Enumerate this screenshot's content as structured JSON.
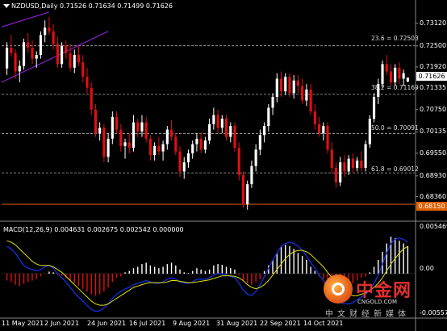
{
  "header": {
    "symbol": "NZDUSD,Daily",
    "ohlc": "0.71526 0.71634 0.71499 0.71626",
    "menu_icon": "triangle-down-icon"
  },
  "macd_header": "MACD(12,26,9) 0.004631 0.002675 0.002542 0.000000",
  "price_axis": {
    "ticks": [
      "0.73120",
      "0.72500",
      "0.71920",
      "0.71335",
      "0.70750",
      "0.70135",
      "0.69550",
      "0.68930",
      "0.68360"
    ],
    "current_price": "0.71626",
    "hline_price": "0.68150"
  },
  "macd_axis": {
    "ticks": [
      "0.005469",
      "0.00",
      "-0.005573"
    ]
  },
  "fib_levels": [
    {
      "label": "23.6 = 0.72503",
      "price": 0.72503
    },
    {
      "label": "38.2 = 0.71169",
      "price": 0.71169
    },
    {
      "label": "50.0 = 0.70091",
      "price": 0.70091
    },
    {
      "label": "61.8 = 0.69012",
      "price": 0.69012
    }
  ],
  "date_labels": [
    "11 May 2021",
    "2 Jun 2021",
    "24 Jun 2021",
    "16 Jul 2021",
    "9 Aug 2021",
    "31 Aug 2021",
    "22 Sep 2021",
    "14 Oct 2021"
  ],
  "watermark": {
    "brand": "中金网",
    "url": "CNGOLD.COM",
    "subtitle": "中文财经新媒体"
  },
  "colors": {
    "background": "#000000",
    "bull": "#ffffff",
    "bear": "#e01010",
    "macd_line": "#1030e0",
    "signal_line": "#e0e000",
    "channel": "#a020f0",
    "hline": "#e06000"
  },
  "chart_data": {
    "type": "candlestick",
    "ylim": [
      0.6795,
      0.7345
    ],
    "candles": [
      [
        0.7188,
        0.726,
        0.717,
        0.7245
      ],
      [
        0.7245,
        0.728,
        0.722,
        0.723
      ],
      [
        0.723,
        0.724,
        0.716,
        0.718
      ],
      [
        0.718,
        0.721,
        0.715,
        0.7195
      ],
      [
        0.7195,
        0.727,
        0.7185,
        0.726
      ],
      [
        0.726,
        0.7285,
        0.723,
        0.7245
      ],
      [
        0.7245,
        0.7265,
        0.72,
        0.7215
      ],
      [
        0.7215,
        0.7235,
        0.719,
        0.7225
      ],
      [
        0.7225,
        0.729,
        0.7215,
        0.728
      ],
      [
        0.728,
        0.732,
        0.726,
        0.73
      ],
      [
        0.73,
        0.733,
        0.728,
        0.729
      ],
      [
        0.729,
        0.731,
        0.724,
        0.7255
      ],
      [
        0.7255,
        0.7275,
        0.719,
        0.72
      ],
      [
        0.72,
        0.726,
        0.719,
        0.725
      ],
      [
        0.725,
        0.7265,
        0.7215,
        0.723
      ],
      [
        0.723,
        0.7255,
        0.718,
        0.719
      ],
      [
        0.719,
        0.724,
        0.7175,
        0.7225
      ],
      [
        0.7225,
        0.725,
        0.7195,
        0.7205
      ],
      [
        0.7205,
        0.7225,
        0.715,
        0.7165
      ],
      [
        0.7165,
        0.719,
        0.712,
        0.7135
      ],
      [
        0.7135,
        0.715,
        0.706,
        0.7075
      ],
      [
        0.7075,
        0.709,
        0.7,
        0.701
      ],
      [
        0.701,
        0.704,
        0.699,
        0.7025
      ],
      [
        0.7025,
        0.7035,
        0.693,
        0.6945
      ],
      [
        0.6945,
        0.701,
        0.693,
        0.6995
      ],
      [
        0.6995,
        0.707,
        0.698,
        0.7055
      ],
      [
        0.7055,
        0.707,
        0.701,
        0.702
      ],
      [
        0.702,
        0.7035,
        0.696,
        0.6975
      ],
      [
        0.6975,
        0.6995,
        0.694,
        0.6985
      ],
      [
        0.6985,
        0.701,
        0.6955,
        0.697
      ],
      [
        0.697,
        0.706,
        0.696,
        0.704
      ],
      [
        0.704,
        0.705,
        0.7,
        0.7015
      ],
      [
        0.7015,
        0.706,
        0.7,
        0.704
      ],
      [
        0.704,
        0.7055,
        0.6985,
        0.6995
      ],
      [
        0.6995,
        0.7005,
        0.6935,
        0.695
      ],
      [
        0.695,
        0.6985,
        0.6935,
        0.6975
      ],
      [
        0.6975,
        0.7,
        0.695,
        0.696
      ],
      [
        0.696,
        0.699,
        0.6935,
        0.698
      ],
      [
        0.698,
        0.703,
        0.6965,
        0.702
      ],
      [
        0.702,
        0.7045,
        0.699,
        0.7
      ],
      [
        0.7,
        0.701,
        0.695,
        0.696
      ],
      [
        0.696,
        0.6975,
        0.689,
        0.6905
      ],
      [
        0.6905,
        0.6945,
        0.6885,
        0.693
      ],
      [
        0.693,
        0.6965,
        0.6915,
        0.6955
      ],
      [
        0.6955,
        0.699,
        0.694,
        0.698
      ],
      [
        0.698,
        0.701,
        0.696,
        0.6995
      ],
      [
        0.6995,
        0.701,
        0.6955,
        0.6965
      ],
      [
        0.6965,
        0.7,
        0.6955,
        0.699
      ],
      [
        0.699,
        0.705,
        0.698,
        0.7035
      ],
      [
        0.7035,
        0.708,
        0.702,
        0.706
      ],
      [
        0.706,
        0.7075,
        0.701,
        0.7025
      ],
      [
        0.7025,
        0.706,
        0.701,
        0.705
      ],
      [
        0.705,
        0.706,
        0.699,
        0.7
      ],
      [
        0.7,
        0.704,
        0.6985,
        0.703
      ],
      [
        0.703,
        0.704,
        0.696,
        0.697
      ],
      [
        0.697,
        0.6985,
        0.688,
        0.6895
      ],
      [
        0.6895,
        0.6905,
        0.6805,
        0.6815
      ],
      [
        0.6815,
        0.688,
        0.68,
        0.687
      ],
      [
        0.687,
        0.6935,
        0.686,
        0.692
      ],
      [
        0.692,
        0.698,
        0.6905,
        0.6965
      ],
      [
        0.6965,
        0.702,
        0.695,
        0.7005
      ],
      [
        0.7005,
        0.704,
        0.6985,
        0.703
      ],
      [
        0.703,
        0.709,
        0.7015,
        0.708
      ],
      [
        0.708,
        0.712,
        0.706,
        0.711
      ],
      [
        0.711,
        0.7175,
        0.7095,
        0.716
      ],
      [
        0.716,
        0.718,
        0.711,
        0.7125
      ],
      [
        0.7125,
        0.7175,
        0.7115,
        0.7165
      ],
      [
        0.7165,
        0.7175,
        0.711,
        0.712
      ],
      [
        0.712,
        0.717,
        0.7105,
        0.7155
      ],
      [
        0.7155,
        0.717,
        0.712,
        0.714
      ],
      [
        0.714,
        0.716,
        0.709,
        0.71
      ],
      [
        0.71,
        0.7145,
        0.7085,
        0.713
      ],
      [
        0.713,
        0.7145,
        0.706,
        0.707
      ],
      [
        0.707,
        0.709,
        0.702,
        0.7035
      ],
      [
        0.7035,
        0.7055,
        0.7,
        0.701
      ],
      [
        0.701,
        0.704,
        0.699,
        0.703
      ],
      [
        0.703,
        0.704,
        0.6955,
        0.6965
      ],
      [
        0.6965,
        0.6985,
        0.69,
        0.6915
      ],
      [
        0.6915,
        0.693,
        0.686,
        0.6875
      ],
      [
        0.6875,
        0.6945,
        0.6865,
        0.693
      ],
      [
        0.693,
        0.695,
        0.689,
        0.6905
      ],
      [
        0.6905,
        0.695,
        0.6895,
        0.694
      ],
      [
        0.694,
        0.6955,
        0.69,
        0.6915
      ],
      [
        0.6915,
        0.6945,
        0.6905,
        0.6935
      ],
      [
        0.6935,
        0.696,
        0.6905,
        0.6915
      ],
      [
        0.6915,
        0.699,
        0.6905,
        0.698
      ],
      [
        0.698,
        0.706,
        0.697,
        0.705
      ],
      [
        0.705,
        0.712,
        0.704,
        0.711
      ],
      [
        0.711,
        0.716,
        0.709,
        0.7145
      ],
      [
        0.7145,
        0.721,
        0.7135,
        0.72
      ],
      [
        0.72,
        0.7225,
        0.717,
        0.718
      ],
      [
        0.718,
        0.72,
        0.714,
        0.715
      ],
      [
        0.715,
        0.72,
        0.714,
        0.719
      ],
      [
        0.719,
        0.7205,
        0.7145,
        0.716
      ],
      [
        0.716,
        0.7185,
        0.714,
        0.7175
      ],
      [
        0.7152,
        0.7163,
        0.715,
        0.7163
      ]
    ],
    "macd_histogram": [
      -0.001,
      -0.0012,
      -0.0016,
      -0.0018,
      -0.0015,
      -0.0012,
      -0.001,
      -0.0008,
      -0.0004,
      0.0,
      0.0003,
      0.0002,
      -0.0002,
      -0.0003,
      -0.0006,
      -0.001,
      -0.0014,
      -0.0018,
      -0.0022,
      -0.0026,
      -0.003,
      -0.0032,
      -0.003,
      -0.0026,
      -0.002,
      -0.0012,
      -0.0006,
      -0.0004,
      0.0002,
      0.0004,
      0.0008,
      0.001,
      0.0014,
      0.0016,
      0.0012,
      0.001,
      0.0008,
      0.001,
      0.0014,
      0.0016,
      0.0012,
      0.0006,
      0.0002,
      0.0001,
      0.0004,
      0.0008,
      0.0006,
      0.0004,
      0.0006,
      0.0012,
      0.0014,
      0.0013,
      0.001,
      0.0008,
      0.0006,
      -0.0002,
      -0.001,
      -0.0014,
      -0.0016,
      -0.0012,
      -0.0008,
      0.0004,
      0.0012,
      0.002,
      0.003,
      0.004,
      0.0042,
      0.004,
      0.0036,
      0.003,
      0.0026,
      0.002,
      0.001,
      0.0004,
      -0.0004,
      -0.0008,
      -0.0014,
      -0.002,
      -0.0024,
      -0.0022,
      -0.002,
      -0.0016,
      -0.0014,
      -0.001,
      -0.0006,
      -0.0004,
      0.0002,
      0.001,
      0.002,
      0.0032,
      0.0044,
      0.0054,
      0.0052,
      0.0048,
      0.0044,
      0.004
    ],
    "macd_line": [
      0.004,
      0.0036,
      0.003,
      0.002,
      0.0012,
      0.0008,
      0.0006,
      0.0004,
      0.0006,
      0.001,
      0.0012,
      0.0008,
      0.0,
      -0.0006,
      -0.0012,
      -0.002,
      -0.0028,
      -0.0034,
      -0.004,
      -0.0046,
      -0.0052,
      -0.0055,
      -0.0054,
      -0.005,
      -0.0044,
      -0.0036,
      -0.003,
      -0.0026,
      -0.0022,
      -0.002,
      -0.0016,
      -0.0014,
      -0.0012,
      -0.001,
      -0.0012,
      -0.0014,
      -0.0014,
      -0.0012,
      -0.0008,
      -0.0006,
      -0.0008,
      -0.0012,
      -0.0014,
      -0.0014,
      -0.0012,
      -0.0008,
      -0.0008,
      -0.0008,
      -0.0006,
      -0.0002,
      0.0,
      0.0,
      -0.0002,
      -0.0004,
      -0.0006,
      -0.0014,
      -0.0024,
      -0.003,
      -0.0032,
      -0.0026,
      -0.0016,
      -0.0004,
      0.0008,
      0.002,
      0.003,
      0.004,
      0.0044,
      0.0046,
      0.0044,
      0.004,
      0.0034,
      0.0026,
      0.0016,
      0.0008,
      -0.0002,
      -0.001,
      -0.002,
      -0.003,
      -0.0038,
      -0.0042,
      -0.0044,
      -0.0044,
      -0.0042,
      -0.0038,
      -0.0034,
      -0.003,
      -0.0024,
      -0.0014,
      -0.0002,
      0.0014,
      0.003,
      0.0044,
      0.005,
      0.0052,
      0.005,
      0.0046
    ],
    "signal_line": [
      0.0048,
      0.0046,
      0.0042,
      0.0036,
      0.003,
      0.0024,
      0.0018,
      0.0014,
      0.0012,
      0.0012,
      0.0012,
      0.001,
      0.0006,
      0.0002,
      -0.0004,
      -0.001,
      -0.0016,
      -0.0022,
      -0.0028,
      -0.0034,
      -0.004,
      -0.0044,
      -0.0046,
      -0.0046,
      -0.0044,
      -0.004,
      -0.0036,
      -0.0032,
      -0.0028,
      -0.0024,
      -0.002,
      -0.0018,
      -0.0016,
      -0.0014,
      -0.0013,
      -0.0013,
      -0.0013,
      -0.0013,
      -0.0012,
      -0.001,
      -0.001,
      -0.0011,
      -0.0012,
      -0.0013,
      -0.0013,
      -0.0012,
      -0.0011,
      -0.001,
      -0.0009,
      -0.0007,
      -0.0005,
      -0.0003,
      -0.0003,
      -0.0003,
      -0.0004,
      -0.0006,
      -0.001,
      -0.0016,
      -0.002,
      -0.0022,
      -0.002,
      -0.0016,
      -0.001,
      -0.0002,
      0.0006,
      0.0014,
      0.0022,
      0.0028,
      0.0032,
      0.0034,
      0.0034,
      0.0032,
      0.0028,
      0.0022,
      0.0016,
      0.001,
      0.0002,
      -0.0006,
      -0.0014,
      -0.002,
      -0.0026,
      -0.003,
      -0.0032,
      -0.0032,
      -0.003,
      -0.0028,
      -0.0024,
      -0.002,
      -0.0014,
      -0.0006,
      0.0004,
      0.0014,
      0.0022,
      0.003,
      0.0036,
      0.004
    ],
    "macd_ylim": [
      -0.006,
      0.006
    ],
    "hline_value": 0.6815
  }
}
